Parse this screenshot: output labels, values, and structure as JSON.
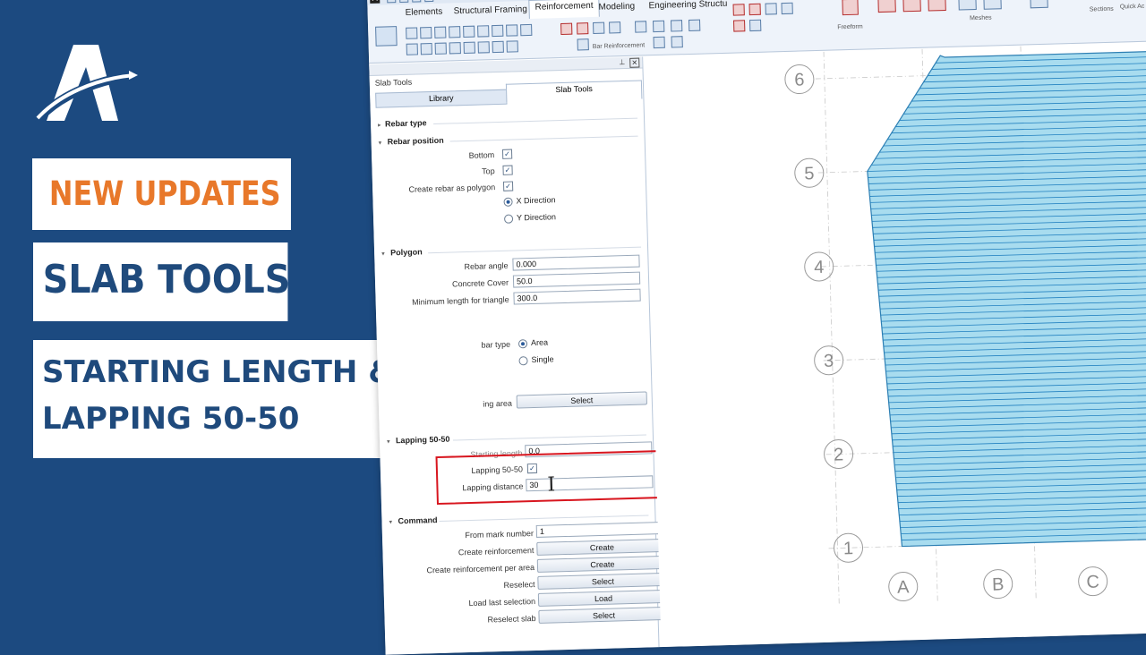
{
  "promo": {
    "badge": "NEW UPDATES",
    "feature": "SLAB TOOLS",
    "headline_line1": "STARTING LENGTH &",
    "headline_line2": "LAPPING 50-50",
    "colors": {
      "panel_bg": "#1c4a80",
      "accent_orange": "#e8782a",
      "navy_text": "#1f4a7c"
    },
    "logo_icon": "a-arrow-logo-icon"
  },
  "ribbon": {
    "app_logo": "A",
    "tabs": [
      "Elements",
      "Structural Framing",
      "Reinforcement",
      "Modeling",
      "Engineering Structu"
    ],
    "active_tab": "Reinforcement",
    "groups": [
      "Bar Reinforcement",
      "Freeform",
      "Meshes",
      "Sections",
      "Quick Ac"
    ]
  },
  "panel": {
    "title": "Slab Tools",
    "tabs": [
      "Library",
      "Slab Tools"
    ],
    "sections": {
      "rebar_type": "Rebar type",
      "rebar_position": {
        "title": "Rebar position",
        "bottom_label": "Bottom",
        "bottom_checked": true,
        "top_label": "Top",
        "top_checked": true,
        "polygon_label": "Create rebar as polygon",
        "polygon_checked": true,
        "x_direction": "X Direction",
        "y_direction": "Y Direction",
        "direction_selected": "X Direction"
      },
      "polygon": {
        "title": "Polygon",
        "rebar_angle_label": "Rebar angle",
        "rebar_angle_value": "0.000",
        "concrete_cover_label": "Concrete Cover",
        "concrete_cover_value": "50.0",
        "min_length_label": "Minimum length for triangle",
        "min_length_value": "300.0"
      },
      "bar_type": {
        "label": "bar type",
        "area": "Area",
        "single": "Single",
        "selected": "Area",
        "area_label": "ing area",
        "select_button": "Select"
      },
      "lapping": {
        "title": "Lapping 50-50",
        "starting_length_label": "Starting length",
        "starting_length_value": "0.0",
        "lapping_label": "Lapping 50-50",
        "lapping_checked": true,
        "distance_label": "Lapping distance",
        "distance_value": "30"
      },
      "command": {
        "title": "Command",
        "from_mark_label": "From mark number",
        "from_mark_value": "1",
        "create_reinf_label": "Create reinforcement",
        "create_reinf_button": "Create",
        "create_per_area_label": "Create reinforcement per area",
        "create_per_area_button": "Create",
        "reselect_label": "Reselect",
        "reselect_button": "Select",
        "load_last_label": "Load last selection",
        "load_last_button": "Load",
        "reselect_slab_label": "Reselect slab",
        "reselect_slab_button": "Select"
      }
    }
  },
  "drawing": {
    "row_grid_labels": [
      "6",
      "5",
      "4",
      "3",
      "2",
      "1"
    ],
    "column_grid_labels": [
      "A",
      "B",
      "C"
    ],
    "slab_fill_color": "#a8dcef",
    "rebar_line_color": "#1f7fbf"
  }
}
